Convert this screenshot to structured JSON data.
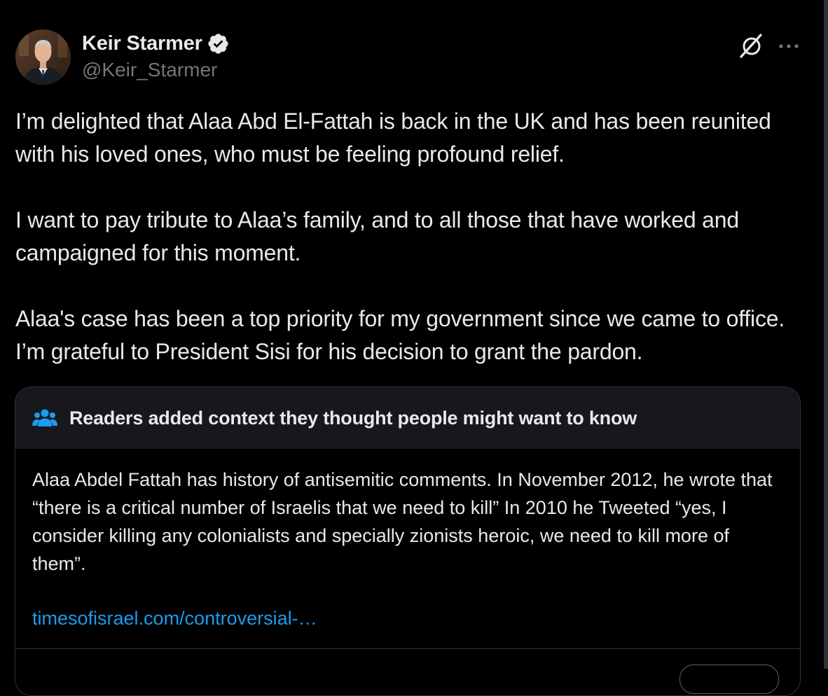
{
  "author": {
    "display_name": "Keir Starmer",
    "handle": "@Keir_Starmer",
    "verified_icon": "verified-badge-icon",
    "avatar": "avatar"
  },
  "actions": {
    "grok_icon": "grok-icon",
    "more_icon": "more-options-icon"
  },
  "tweet": {
    "paragraphs": [
      "I’m delighted that Alaa Abd El-Fattah is back in the UK and has been reunited with his loved ones, who must be feeling profound relief.",
      "I want to pay tribute to Alaa’s family, and to all those that have worked and campaigned for this moment.",
      "Alaa's case has been a top priority for my government since we came to office. I’m grateful to President Sisi for his decision to grant the pardon."
    ]
  },
  "community_note": {
    "icon": "people-icon",
    "title": "Readers added context they thought people might want to know",
    "body": "Alaa Abdel Fattah has history of antisemitic comments. In November 2012, he wrote that “there is a critical number of Israelis that we need to kill” In 2010 he Tweeted “yes, I consider killing any colonialists and specially zionists heroic, we need to kill more of them”.",
    "link_text": "timesofisrael.com/controversial-…"
  },
  "colors": {
    "background": "#000000",
    "text": "#e7e9ea",
    "secondary_text": "#71767b",
    "accent": "#1d9bf0",
    "note_header_bg": "#16181c",
    "border": "#2f3336"
  }
}
